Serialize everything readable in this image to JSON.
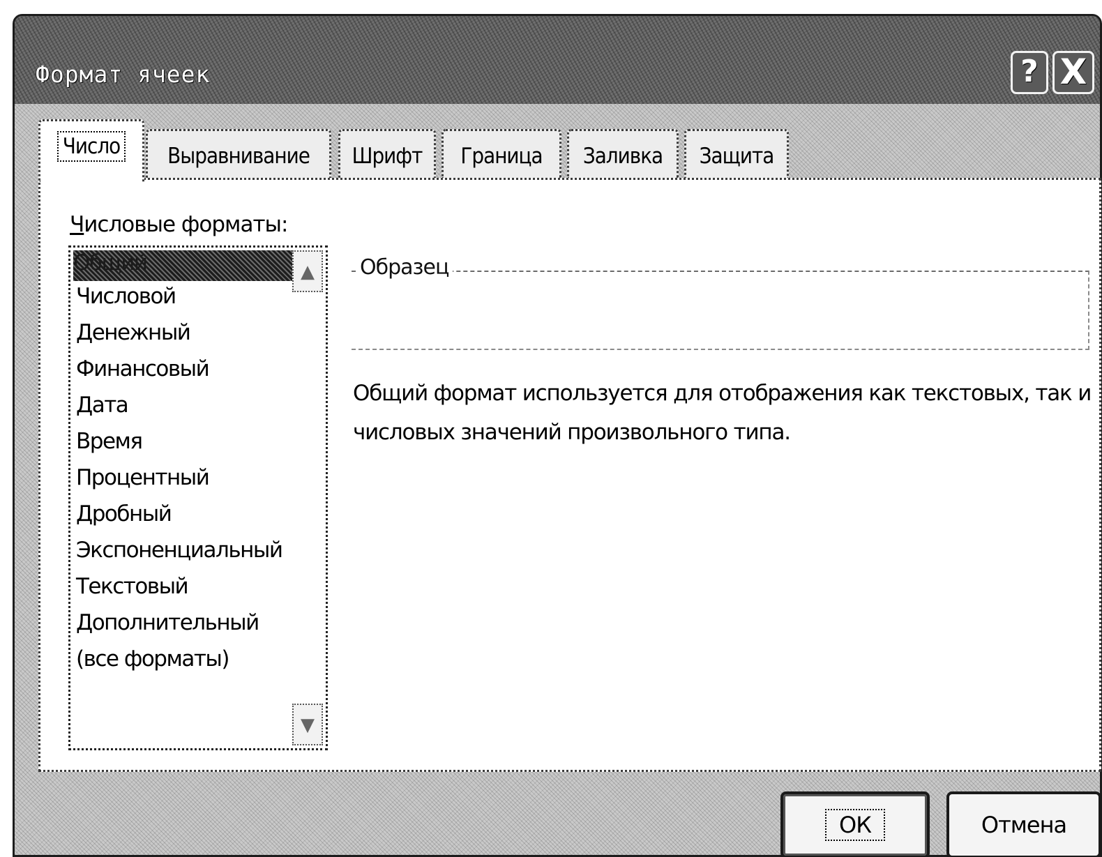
{
  "window": {
    "title": "Формат ячеек",
    "help_label": "?",
    "close_label": "X"
  },
  "tabs": [
    {
      "label": "Число",
      "active": true
    },
    {
      "label": "Выравнивание",
      "active": false
    },
    {
      "label": "Шрифт",
      "active": false
    },
    {
      "label": "Граница",
      "active": false
    },
    {
      "label": "Заливка",
      "active": false
    },
    {
      "label": "Защита",
      "active": false
    }
  ],
  "number_formats": {
    "label_accel": "Ч",
    "label_rest": "исловые форматы:",
    "items": [
      "Общий",
      "Числовой",
      "Денежный",
      "Финансовый",
      "Дата",
      "Время",
      "Процентный",
      "Дробный",
      "Экспоненциальный",
      "Текстовый",
      "Дополнительный",
      "(все форматы)"
    ],
    "selected_index": 0
  },
  "sample": {
    "label": "Образец"
  },
  "description": "Общий формат используется для отображения как текстовых, так и числовых значений произвольного типа.",
  "buttons": {
    "ok": "ОК",
    "cancel": "Отмена"
  },
  "icons": {
    "scroll_up": "scroll-up-arrow-icon",
    "scroll_down": "scroll-down-arrow-icon"
  }
}
